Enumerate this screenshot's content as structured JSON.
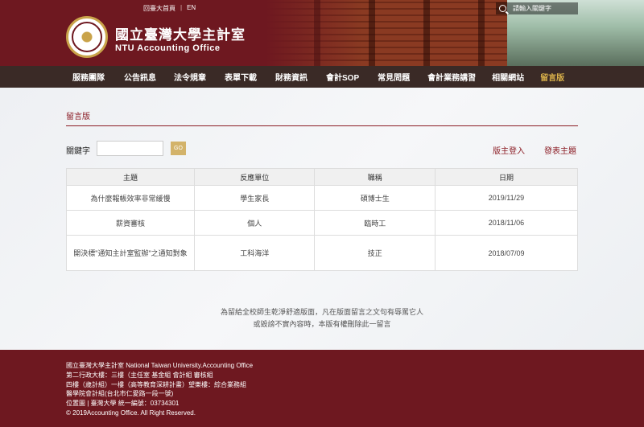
{
  "topbar": {
    "home": "回臺大首頁",
    "sep": "|",
    "lang": "EN",
    "search_placeholder": "請輸入關鍵字"
  },
  "site": {
    "title": "國立臺灣大學主計室",
    "subtitle": "NTU Accounting Office"
  },
  "nav": {
    "items": [
      {
        "label": "服務團隊"
      },
      {
        "label": "公告訊息"
      },
      {
        "label": "法令規章"
      },
      {
        "label": "表單下載"
      },
      {
        "label": "財務資訊"
      },
      {
        "label": "會計SOP"
      },
      {
        "label": "常見問題"
      },
      {
        "label": "會計業務講習"
      },
      {
        "label": "相關網站"
      },
      {
        "label": "留言版"
      }
    ]
  },
  "page": {
    "title": "留言版",
    "keyword_label": "關鍵字",
    "keyword_value": "",
    "go_label": "GO",
    "login_link": "版主登入",
    "post_link": "發表主題"
  },
  "table": {
    "headers": [
      "主題",
      "反應單位",
      "職稱",
      "日期"
    ],
    "rows": [
      {
        "subject": "為什麼報帳效率非常緩慢",
        "unit": "學生家長",
        "title": "碩博士生",
        "date": "2019/11/29"
      },
      {
        "subject": "薪資審核",
        "unit": "個人",
        "title": "臨時工",
        "date": "2018/11/06"
      },
      {
        "subject": "開決標\"通知主計室監辦\"之通知對象",
        "unit": "工科海洋",
        "title": "技正",
        "date": "2018/07/09"
      }
    ]
  },
  "notice": {
    "line1": "為留給全校師生乾淨舒適版面，凡在版面留言之文句有辱罵它人",
    "line2": "或毀謗不實內容時，本版有權刪除此一留言"
  },
  "footer": {
    "lines": [
      "國立臺灣大學主計室 National Taiwan University.Accounting Office",
      "第二行政大樓：三樓（主任室 基金組 會計組 審核組",
      "四樓（歲計組）一樓（高等教育深耕計畫）望樂樓：綜合業務組",
      "醫學院會計組(台北市仁愛路一段一號)",
      "位置圖 | 臺灣大學 統一編號：03734301",
      "© 2019Accounting Office. All Right Reserved."
    ]
  },
  "colors": {
    "brand": "#6e1820",
    "nav_bg": "#3a2a26",
    "accent_gold": "#d8b04a",
    "link": "#8b1c24"
  }
}
